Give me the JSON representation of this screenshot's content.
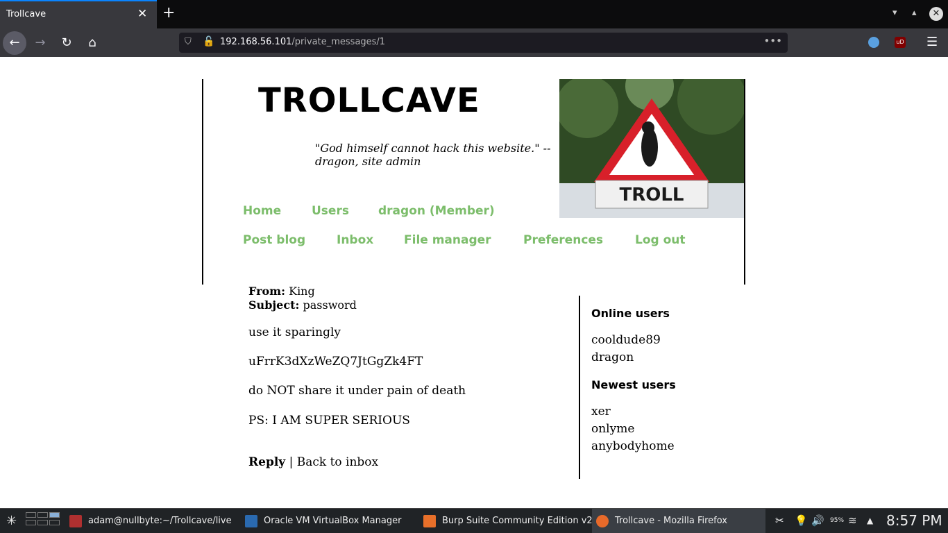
{
  "browser": {
    "tab_title": "Trollcave",
    "tab_close": "✕",
    "new_tab": "+",
    "url_host": "192.168.56.101",
    "url_path": "/private_messages/1",
    "url_more": "•••"
  },
  "site": {
    "title": "TROLLCAVE",
    "tagline": "\"God himself cannot hack this website.\" -- dragon, site admin",
    "banner_sign_text": "TROLL",
    "nav_row1": [
      "Home",
      "Users",
      "dragon (Member)"
    ],
    "nav_row2": [
      "Post blog",
      "Inbox",
      "File manager",
      "Preferences",
      "Log out"
    ]
  },
  "message": {
    "from_label": "From:",
    "from_value": "King",
    "subject_label": "Subject:",
    "subject_value": "password",
    "body": [
      "use it sparingly",
      "uFrrK3dXzWeZQ7JtGgZk4FT",
      "do NOT share it under pain of death",
      "PS: I AM SUPER SERIOUS"
    ],
    "reply_label": "Reply",
    "separator": "|",
    "back_label": "Back to inbox"
  },
  "sidebar": {
    "online_heading": "Online users",
    "online_users": [
      "cooldude89",
      "dragon"
    ],
    "newest_heading": "Newest users",
    "newest_users": [
      "xer",
      "onlyme",
      "anybodyhome"
    ]
  },
  "taskbar": {
    "tasks": [
      "adam@nullbyte:~/Trollcave/live",
      "Oracle VM VirtualBox Manager",
      "Burp Suite Community Edition v2...",
      "Trollcave - Mozilla Firefox"
    ],
    "battery": "95%",
    "clock": "8:57 PM"
  },
  "colors": {
    "link_green": "#7cbd6b",
    "tab_accent": "#0a84ff",
    "chrome_dark": "#0c0c0d",
    "toolbar": "#38383d"
  }
}
